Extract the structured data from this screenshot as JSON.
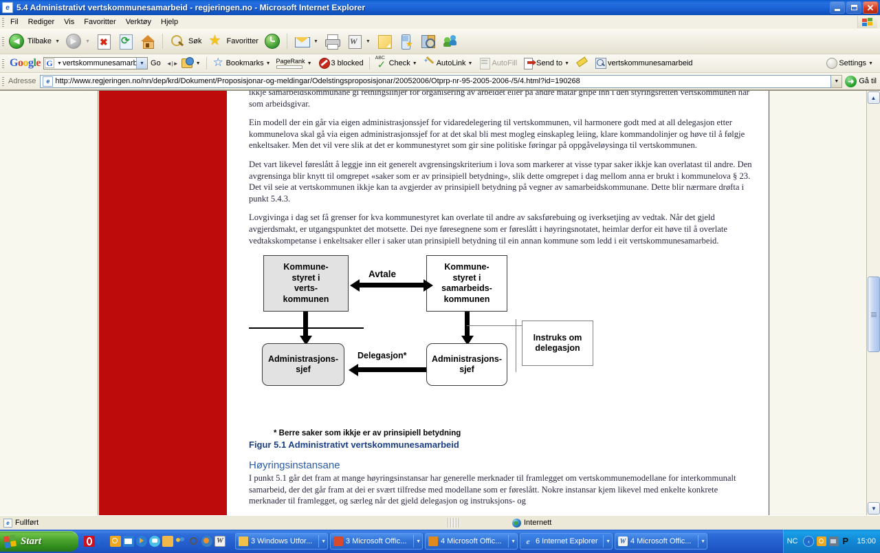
{
  "window": {
    "title": "5.4 Administrativt vertskommunesamarbeid - regjeringen.no - Microsoft Internet Explorer",
    "icon": "ie-page-icon",
    "minimize_label": "Minimize",
    "maximize_label": "Restore",
    "close_label": "Close"
  },
  "menu": {
    "items": [
      {
        "label": "Fil",
        "name": "menu-fil"
      },
      {
        "label": "Rediger",
        "name": "menu-rediger"
      },
      {
        "label": "Vis",
        "name": "menu-vis"
      },
      {
        "label": "Favoritter",
        "name": "menu-favoritter"
      },
      {
        "label": "Verktøy",
        "name": "menu-verktoy"
      },
      {
        "label": "Hjelp",
        "name": "menu-hjelp"
      }
    ]
  },
  "toolbar": {
    "back_label": "Tilbake",
    "forward_label": "Fram",
    "stop_label": "Stopp",
    "refresh_label": "Oppdater",
    "home_label": "Hjem",
    "search_label": "Søk",
    "favorites_label": "Favoritter",
    "history_label": "Logg",
    "mail_label": "E-post",
    "print_label": "Skriv ut",
    "edit_label": "Rediger i Word",
    "notes_label": "Notat",
    "mobile_label": "Mobil favoritt",
    "research_label": "Referanse",
    "messenger_label": "Messenger"
  },
  "google_bar": {
    "logo": "Google",
    "search_value": "vertskommunesamarbeid\"",
    "go_label": "Go",
    "bookmarks_label": "Bookmarks",
    "pagerank_label": "PageRank",
    "blocked_label": "3 blocked",
    "check_label": "Check",
    "autolink_label": "AutoLink",
    "autofill_label": "AutoFill",
    "sendto_label": "Send to",
    "highlight_term": "vertskommunesamarbeid",
    "settings_label": "Settings"
  },
  "address_bar": {
    "label": "Adresse",
    "url": "http://www.regjeringen.no/nn/dep/krd/Dokument/Proposisjonar-og-meldingar/Odelstingsproposisjonar/20052006/Otprp-nr-95-2005-2006-/5/4.html?id=190268",
    "go_label": "Gå til"
  },
  "page": {
    "accent_red": "#bd0a0a",
    "paragraphs": [
      "ikkje samarbeidskommunane gi retningslinjer for organisering av arbeidet eller på andre måtar gripe inn i den styringsretten vertskommunen har som arbeidsgivar.",
      "Ein modell der ein går via eigen administrasjonssjef for vidaredelegering til vertskommunen, vil harmonere godt med at all delegasjon etter kommunelova skal gå via eigen administrasjonssjef for at det skal bli mest mogleg einskapleg leiing, klare kommandolinjer og høve til å følgje enkeltsaker. Men det vil vere slik at det er kommunestyret som gir sine politiske føringar på oppgåveløysinga til vertskommunen.",
      "Det vart likevel føreslått å leggje inn eit generelt avgrensingskriterium i lova som markerer at visse typar saker ikkje kan overlatast til andre. Den avgrensinga blir knytt til omgrepet «saker som er av prinsipiell betydning», slik dette omgrepet i dag mellom anna er brukt i kommunelova § 23. Det vil seie at vertskommunen ikkje kan ta avgjerder av prinsipiell betydning på vegner av samarbeidskommunane. Dette blir nærmare drøfta i punkt 5.4.3.",
      "Lovgivinga i dag set få grenser for kva kommunestyret kan overlate til andre av saksførebuing og iverksetjing av vedtak. Når det gjeld avgjerdsmakt, er utgangspunktet det motsette. Dei nye føresegnene som er føreslått i høyringsnotatet, heimlar derfor eit høve til å overlate vedtakskompetanse i enkeltsaker eller i saker utan prinsipiell betydning til ein annan kommune som ledd i eit vertskommunesamarbeid."
    ],
    "diagram": {
      "node_host_council": "Kommune-\nstyret i\nverts-\nkommunen",
      "node_partner_council": "Kommune-\nstyret i\nsamarbeids-\nkommunen",
      "node_host_admin": "Administrasjons-\nsjef",
      "node_partner_admin": "Administrasjons-\nsjef",
      "node_instruction": "Instruks om\ndelegasjon",
      "label_agreement": "Avtale",
      "label_delegation": "Delegasjon*"
    },
    "footnote": "* Berre saker som ikkje er av prinsipiell betydning",
    "figure_caption": "Figur 5.1 Administrativt vertskommunesamarbeid",
    "section_heading": "Høyringsinstansane",
    "section_paragraph": "I punkt 5.1 går det fram at mange høyringsinstansar har generelle merknader til framlegget om vertskommunemodellane for interkommunalt samarbeid, der det går fram at dei er svært tilfredse med modellane som er føreslått. Nokre instansar kjem likevel med enkelte konkrete merknader til framlegget, og særleg når det gjeld delegasjon og instruksjons- og"
  },
  "status_bar": {
    "text": "Fullført",
    "zone": "Internett"
  },
  "taskbar": {
    "start_label": "Start",
    "buttons": [
      {
        "label": "3 Windows Utfor...",
        "name": "taskbar-windows-explorer",
        "color": "#f2c14b"
      },
      {
        "label": "3 Microsoft Offic...",
        "name": "taskbar-office-1",
        "color": "#d94a2a"
      },
      {
        "label": "4 Microsoft Offic...",
        "name": "taskbar-office-2",
        "color": "#e08a1e"
      },
      {
        "label": "6 Internet Explorer",
        "name": "taskbar-internet-explorer",
        "color": "#2a7fd4"
      },
      {
        "label": "4 Microsoft Offic...",
        "name": "taskbar-office-3",
        "color": "#2a5fae"
      }
    ],
    "tray_label": "NC",
    "clock": "15:00"
  }
}
